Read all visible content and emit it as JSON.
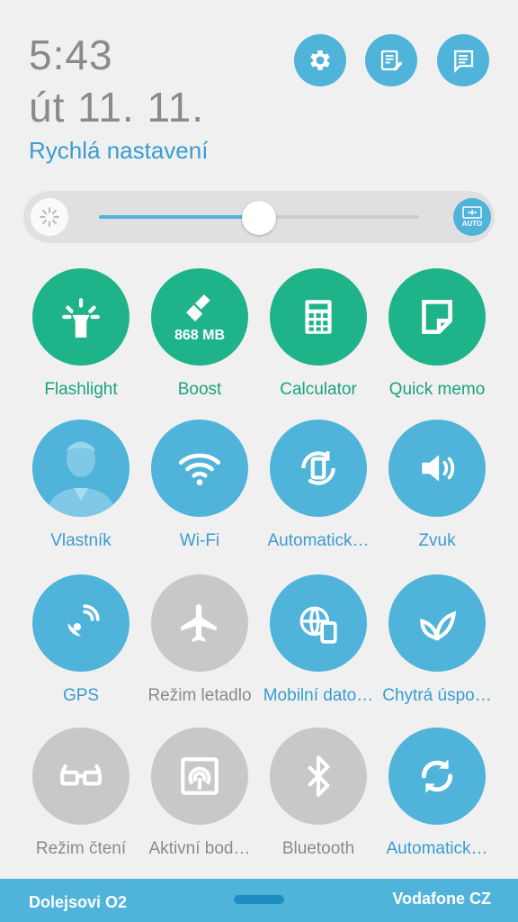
{
  "header": {
    "time": "5:43",
    "date": "út 11. 11.",
    "section_title": "Rychlá nastavení",
    "buttons": [
      "gear-icon",
      "edit-note-icon",
      "message-list-icon"
    ]
  },
  "brightness": {
    "level": 0.5,
    "auto_label": "AUTO"
  },
  "tiles": [
    {
      "label": "Flashlight",
      "icon": "flashlight-icon",
      "state": "on",
      "color": "#1fb38a"
    },
    {
      "label": "Boost",
      "sub": "868 MB",
      "icon": "broom-icon",
      "state": "on",
      "color": "#1fb38a"
    },
    {
      "label": "Calculator",
      "icon": "calculator-icon",
      "state": "on",
      "color": "#1fb38a"
    },
    {
      "label": "Quick memo",
      "icon": "memo-icon",
      "state": "on",
      "color": "#1fb38a"
    },
    {
      "label": "Vlastník",
      "icon": "user-avatar-icon",
      "state": "on",
      "color": "#4fb3da"
    },
    {
      "label": "Wi-Fi",
      "icon": "wifi-icon",
      "state": "on",
      "color": "#4fb3da"
    },
    {
      "label": "Automatick…",
      "icon": "auto-rotate-icon",
      "state": "on",
      "color": "#4fb3da"
    },
    {
      "label": "Zvuk",
      "icon": "speaker-icon",
      "state": "on",
      "color": "#4fb3da"
    },
    {
      "label": "GPS",
      "icon": "satellite-icon",
      "state": "on",
      "color": "#4fb3da"
    },
    {
      "label": "Režim letadlo",
      "icon": "airplane-icon",
      "state": "off",
      "color": "#c8c8c8"
    },
    {
      "label": "Mobilní dato…",
      "icon": "mobile-data-icon",
      "state": "on",
      "color": "#4fb3da"
    },
    {
      "label": "Chytrá úspo…",
      "icon": "leaf-icon",
      "state": "on",
      "color": "#4fb3da"
    },
    {
      "label": "Režim čtení",
      "icon": "glasses-icon",
      "state": "off",
      "color": "#c8c8c8"
    },
    {
      "label": "Aktivní bod…",
      "icon": "hotspot-icon",
      "state": "off",
      "color": "#c8c8c8"
    },
    {
      "label": "Bluetooth",
      "icon": "bluetooth-icon",
      "state": "off",
      "color": "#c8c8c8"
    },
    {
      "label": "Automatick…",
      "icon": "sync-icon",
      "state": "on",
      "color": "#4fb3da"
    }
  ],
  "footer": {
    "carrier_left": "Dolejsovi O2",
    "carrier_right": "Vodafone CZ"
  }
}
